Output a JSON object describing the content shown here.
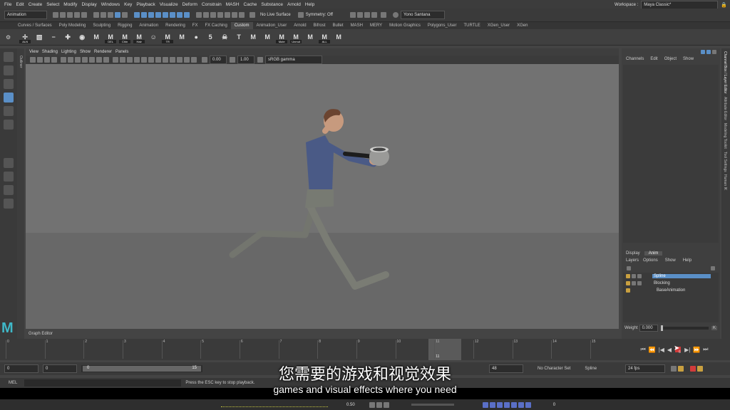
{
  "menubar": [
    "File",
    "Edit",
    "Create",
    "Select",
    "Modify",
    "Display",
    "Windows",
    "Key",
    "Playback",
    "Visualize",
    "Deform",
    "Constrain",
    "MASH",
    "Cache",
    "Substance",
    "Arnold",
    "Help"
  ],
  "workspace": {
    "label": "Workspace :",
    "value": "Maya Classic*"
  },
  "status": {
    "mode": "Animation",
    "live_surface": "No Live Surface",
    "symmetry": "Symmetry: Off",
    "user": "Yono Santana"
  },
  "shelf_tabs": [
    "Curves / Surfaces",
    "Poly Modeling",
    "Sculpting",
    "Rigging",
    "Animation",
    "Rendering",
    "FX",
    "FX Caching",
    "Custom",
    "Animation_User",
    "Arnold",
    "Bifrost",
    "Bullet",
    "MASH",
    "MERY",
    "Motion Graphics",
    "Polygons_User",
    "TURTLE",
    "XGen_User",
    "XGen"
  ],
  "shelf_active": "Custom",
  "shelf_items": [
    {
      "glyph": "✢",
      "label": "ALN"
    },
    {
      "glyph": "▧",
      "label": ""
    },
    {
      "glyph": "−",
      "label": ""
    },
    {
      "glyph": "✚",
      "label": ""
    },
    {
      "glyph": "◉",
      "label": ""
    },
    {
      "glyph": "M",
      "label": ""
    },
    {
      "glyph": "M",
      "label": "DEL"
    },
    {
      "glyph": "M",
      "label": "Chin"
    },
    {
      "glyph": "M",
      "label": "Hair"
    },
    {
      "glyph": "☺",
      "label": ""
    },
    {
      "glyph": "M",
      "label": "TR"
    },
    {
      "glyph": "M",
      "label": ""
    },
    {
      "glyph": "●",
      "label": ""
    },
    {
      "glyph": "5",
      "label": ""
    },
    {
      "glyph": "☠",
      "label": ""
    },
    {
      "glyph": "T",
      "label": ""
    },
    {
      "glyph": "M",
      "label": ""
    },
    {
      "glyph": "M",
      "label": ""
    },
    {
      "glyph": "M",
      "label": "Mute"
    },
    {
      "glyph": "M",
      "label": "Unmut"
    },
    {
      "glyph": "M",
      "label": ""
    },
    {
      "glyph": "M",
      "label": "ALL"
    },
    {
      "glyph": "M",
      "label": ""
    }
  ],
  "viewport_menu": [
    "View",
    "Shading",
    "Lighting",
    "Show",
    "Renderer",
    "Panels"
  ],
  "viewport_toolbar": {
    "exposure": "0.00",
    "gamma": "1.00",
    "colorspace": "sRGB gamma"
  },
  "outliner_label": "Outliner",
  "channel_box": {
    "menu": [
      "Channels",
      "Edit",
      "Object",
      "Show"
    ]
  },
  "layer_editor": {
    "tabs": [
      "Display",
      "Anim"
    ],
    "active_tab": "Anim",
    "menu": [
      "Layers",
      "Options",
      "Show",
      "Help"
    ],
    "layers": [
      {
        "name": "Spline",
        "selected": true
      },
      {
        "name": "Blocking",
        "selected": false
      },
      {
        "name": "BaseAnimation",
        "selected": false
      }
    ],
    "weight_label": "Weight",
    "weight_value": "0.000",
    "k_label": "K"
  },
  "side_tabs": [
    "Channel Box / Layer Editor",
    "Attribute Editor",
    "Modeling Toolkit",
    "Tool Settings",
    "Human IK"
  ],
  "graph_editor_label": "Graph Editor",
  "timeline": {
    "ticks": [
      "0",
      "1",
      "2",
      "3",
      "4",
      "5",
      "6",
      "7",
      "8",
      "9",
      "10",
      "11",
      "12",
      "13",
      "14",
      "15"
    ],
    "current": "11",
    "current_frame": "6"
  },
  "range": {
    "start": "0",
    "start2": "0",
    "slider_start": "0",
    "slider_end": "15",
    "end_field": "48",
    "char_set": "No Character Set",
    "layer": "Spline",
    "fps": "24 fps"
  },
  "mel": {
    "label": "MEL",
    "help": "Press the ESC key to stop playback."
  },
  "bottom": {
    "value": "0.50",
    "frame": "0"
  },
  "subtitles": {
    "cn": "您需要的游戏和视觉效果",
    "en": "games and visual effects where you need"
  },
  "logo": "M"
}
